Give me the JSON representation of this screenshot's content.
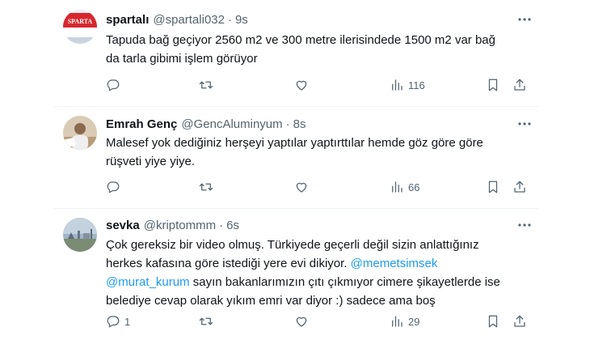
{
  "tweets": [
    {
      "name": "spartalı",
      "handle": "@spartali032",
      "time": "9s",
      "avatar_text": "SPARTA",
      "lines": [
        "Tapuda bağ geçiyor 2560 m2 ve 300 metre ilerisindede 1500 m2 var bağ",
        "da tarla gibimi işlem görüyor"
      ],
      "replies": "",
      "retweets": "",
      "likes": "",
      "views": "116"
    },
    {
      "name": "Emrah Genç",
      "handle": "@GencAluminyum",
      "time": "8s",
      "lines": [
        "Malesef yok dediğiniz herşeyi yaptılar yaptırttılar hemde göz göre göre",
        "rüşveti yiye yiye."
      ],
      "replies": "",
      "retweets": "",
      "likes": "",
      "views": "66"
    },
    {
      "name": "sevka",
      "handle": "@kriptommm",
      "time": "6s",
      "line1": "Çok gereksiz bir video olmuş. Türkiyede geçerli değil sizin anlattığınız",
      "line2_text": "herkes kafasına göre istediği yere evi dikiyor. ",
      "mention1": "@memetsimsek",
      "mention2": "@murat_kurum",
      "line3_text": " sayın bakanlarımızın çıtı çıkmıyor cimere şikayetlerde ise",
      "line4": "belediye cevap olarak yıkım emri var diyor :) sadece ama boş",
      "replies": "1",
      "retweets": "",
      "likes": "",
      "views": "29"
    }
  ],
  "icons": {
    "reply": "reply-icon",
    "retweet": "retweet-icon",
    "like": "heart-icon",
    "views": "views-chart-icon",
    "bookmark": "bookmark-icon",
    "share": "share-icon",
    "more": "more-dots-icon"
  },
  "colors": {
    "text": "#0f1419",
    "secondary": "#536471",
    "link": "#1d9bf0",
    "divider": "#eff3f4"
  }
}
